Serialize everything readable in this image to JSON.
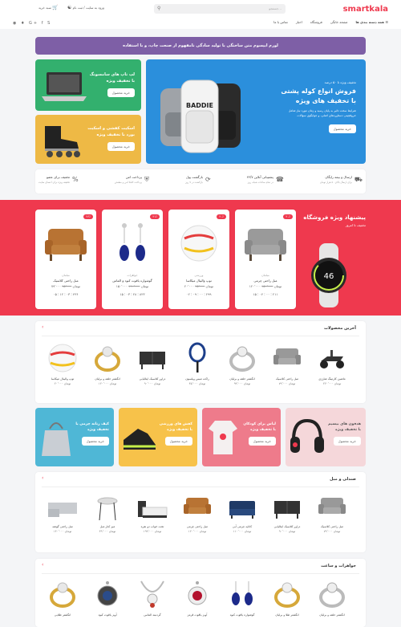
{
  "header": {
    "logo": "smartkala",
    "search_placeholder": "جستجو...",
    "nav": [
      "همه دسته بندی ها",
      "صفحه خانگی",
      "فروشگاه",
      "اخبار",
      "تماس با ما"
    ],
    "login": "ورود به سایت / ثبت نام",
    "cart": "سبد خرید"
  },
  "banner_purple": "لورم ایپسوم متن ساختگی با تولید سادگی نامفهوم از صنعت چاپ، و با استفاده",
  "hero": {
    "subtitle": "تخفیف ویژه تا ۵۰ درصد",
    "title_line1": "فروش انواع کوله پشتی",
    "title_line2": "با تخفیف های ویژه",
    "desc": "شرایط سخت تاثیر به پایان رسید و زمان مورد نیاز شامل حروفچینی دستاوردهای اصلی، و جوابگوی سوالات",
    "button": "خرید محصول",
    "brand": "BADDIE"
  },
  "promo_left": [
    {
      "title1": "لپ تاپ های سامسونگ",
      "title2": "با تخفیف ویژه",
      "button": "خرید محصول",
      "color": "#2db48a"
    },
    {
      "title1": "اسکیت کفشی و اسکیت",
      "title2": "بورد با تخفیف ویژه",
      "button": "خرید محصول",
      "color": "#e7b33f"
    }
  ],
  "features": [
    {
      "title": "ارسال و بیمه رایگان",
      "sub": "برای ارسال بالای ۵۰ هزار تومان",
      "icon": "truck-icon"
    },
    {
      "title": "پشتیبانی آنلاین ۲۴/۷",
      "sub": "در تمام ساعات شبانه روز",
      "icon": "support-icon"
    },
    {
      "title": "بازگشت پول",
      "sub": "بازگشت در ۷ روز",
      "icon": "money-back-icon"
    },
    {
      "title": "پرداخت امن",
      "sub": "پرداخت کاملا امن و مطمئن",
      "icon": "shield-icon"
    },
    {
      "title": "تخفیف برای عضو",
      "sub": "تخفیف ویژه برای اعضای سایت",
      "icon": "percent-icon"
    }
  ],
  "special": {
    "title": "پیشنهاد ویژه فروشگاه",
    "subtitle": "تخفیف تا امروز",
    "watch_text": "46",
    "items": [
      {
        "cat": "مبلمان",
        "name": "مبل راحتی کلاسیک",
        "price": "۷۹٬۰۰۰ تومان",
        "old": "۹۵٬۰۰۰",
        "timer": "۰۵ : ۱۲ : ۰۳ : ۴۳۶",
        "badge": "۲۶٪",
        "icon": "armchair-icon"
      },
      {
        "cat": "ورزشی",
        "name": "توپ والیبال میکاسا",
        "price": "۲۰٬۰۰۰ تومان",
        "old": "۲۵٬۰۰۰",
        "timer": "۰۲ : ۰۹ : ۰۰ : ۲۹۹",
        "badge": "۲۰٪",
        "icon": "volleyball-icon"
      },
      {
        "cat": "جواهرات",
        "name": "گوشواره یاقوت کبود و الماس",
        "price": "۱۵۰٬۰۰۰ تومان",
        "old": "۱۹۰٬۰۰۰",
        "timer": "۱۵ : ۰۳ : ۲۸ : ۸۲۳",
        "badge": "۲۱٪",
        "icon": "earrings-icon"
      },
      {
        "cat": "مبلمان",
        "name": "مبل راحتی چرمی",
        "price": "۱۲۰٬۰۰۰ تومان",
        "old": "۱۵۰٬۰۰۰",
        "timer": "۱۵ : ۰۴ : ۰۰ : ۲۱۱",
        "badge": "۲۰٪",
        "icon": "leather-chair-icon"
      }
    ]
  },
  "latest": {
    "title": "آخرین محصولات",
    "items": [
      {
        "name": "ماشین کارتینگ شارژی",
        "price": "۲۲۰٬۰۰۰ تومان",
        "icon": "gokart-icon"
      },
      {
        "name": "مبل راحتی کلاسیک",
        "price": "۷۹٬۰۰۰ تومان",
        "icon": "armchair-icon"
      },
      {
        "name": "انگشتر حلقه و برلیان",
        "price": "۹۹٬۰۰۰ تومان",
        "icon": "ring-icon"
      },
      {
        "name": "راکت تنیس ویلسون",
        "price": "۴۵٬۰۰۰ تومان",
        "icon": "racket-icon"
      },
      {
        "name": "دراور کلاسیک ایتالیایی",
        "price": "۹۰٬۰۰۰ تومان",
        "icon": "dresser-icon"
      },
      {
        "name": "انگشتر حلقه و برلیان",
        "price": "۱۲۰٬۰۰۰ تومان",
        "icon": "ring-icon"
      },
      {
        "name": "توپ والیبال میکاسا",
        "price": "۲۰٬۰۰۰ تومان",
        "icon": "volleyball-icon"
      }
    ]
  },
  "promo_row": [
    {
      "t1": "هدفون های بیسیم",
      "t2": "با تخفیف ویژه",
      "button": "خرید محصول",
      "color": "#f2d5d8",
      "icon": "headphones-icon"
    },
    {
      "t1": "لباس برای کودکان",
      "t2": "با تخفیف ویژه",
      "button": "خرید محصول",
      "color": "#ee7b8b",
      "icon": "baby-clothes-icon"
    },
    {
      "t1": "کفش های ورزشی",
      "t2": "با تخفیف ویژه",
      "button": "خرید محصول",
      "color": "#f7c24a",
      "icon": "shoe-icon"
    },
    {
      "t1": "کیف زنانه چرمی با",
      "t2": "تخفیف ویژه",
      "button": "خرید محصول",
      "color": "#4fb7d6",
      "icon": "handbag-icon"
    }
  ],
  "furniture": {
    "title": "صندلی و مبل",
    "items": [
      {
        "name": "مبل راحتی کلاسیک",
        "price": "۷۹٬۰۰۰ تومان",
        "icon": "armchair-icon"
      },
      {
        "name": "دراور کلاسیک ایتالیایی",
        "price": "۹۰٬۰۰۰ تومان",
        "icon": "dresser-icon"
      },
      {
        "name": "کاناپه چرمی آبی",
        "price": "۱۱۰٬۰۰۰ تومان",
        "icon": "sofa-icon"
      },
      {
        "name": "مبل راحتی چرمی",
        "price": "۱۲۰٬۰۰۰ تومان",
        "icon": "leather-chair-icon"
      },
      {
        "name": "تخت خواب دو نفره",
        "price": "۱۹۹٬۰۰۰ تومان",
        "icon": "bed-icon"
      },
      {
        "name": "میز کنار مبل",
        "price": "۴۹٬۰۰۰ تومان",
        "icon": "table-icon"
      },
      {
        "name": "مبل راحتی گوشه",
        "price": "۱۴۰٬۰۰۰ تومان",
        "icon": "corner-sofa-icon"
      }
    ]
  },
  "jewelry": {
    "title": "جواهرات و ساعت",
    "items": [
      {
        "name": "انگشتر حلقه و برلیان",
        "icon": "ring-icon"
      },
      {
        "name": "انگشتر طلا و برلیان",
        "icon": "gold-ring-icon"
      },
      {
        "name": "گوشواره یاقوت کبود",
        "icon": "earrings-icon"
      },
      {
        "name": "آویز یاقوت قرمز",
        "icon": "pendant-red-icon"
      },
      {
        "name": "گردنبند الماس",
        "icon": "necklace-icon"
      },
      {
        "name": "آویز یاقوت کبود",
        "icon": "pendant-blue-icon"
      },
      {
        "name": "انگشتر طلایی",
        "icon": "gold-ring-icon"
      }
    ]
  }
}
